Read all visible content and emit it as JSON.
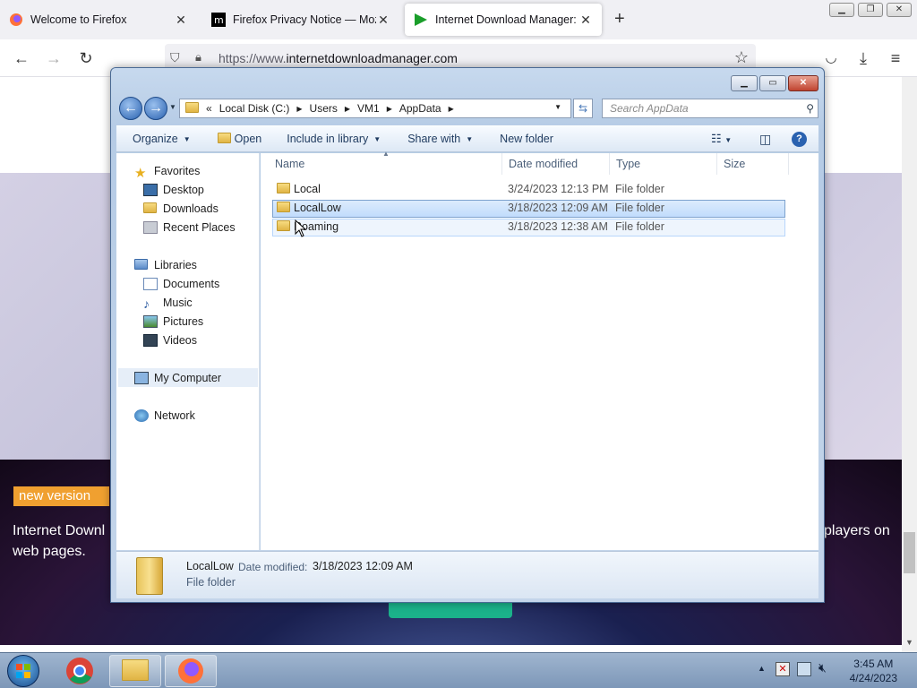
{
  "browser": {
    "tabs": [
      {
        "label": "Welcome to Firefox",
        "icon": "firefox-icon"
      },
      {
        "label": "Firefox Privacy Notice — Mozilla",
        "icon": "mozilla-m-icon"
      },
      {
        "label": "Internet Download Manager: Th",
        "icon": "idm-play-icon",
        "active": true
      }
    ],
    "new_tab": "+",
    "url_prefix": "https://www.",
    "url_domain": "internetdownloadmanager.com"
  },
  "webpage": {
    "badge": "new version",
    "text_left_1": "Internet Downl",
    "text_left_2": "web pages.",
    "text_right": "players on"
  },
  "explorer": {
    "breadcrumb": [
      "«",
      "Local Disk (C:)",
      "Users",
      "VM1",
      "AppData"
    ],
    "search_placeholder": "Search AppData",
    "toolbar": {
      "organize": "Organize",
      "open": "Open",
      "include": "Include in library",
      "share": "Share with",
      "new_folder": "New folder"
    },
    "nav": {
      "favorites": "Favorites",
      "desktop": "Desktop",
      "downloads": "Downloads",
      "recent": "Recent Places",
      "libraries": "Libraries",
      "documents": "Documents",
      "music": "Music",
      "pictures": "Pictures",
      "videos": "Videos",
      "computer": "My Computer",
      "network": "Network"
    },
    "columns": {
      "name": "Name",
      "date": "Date modified",
      "type": "Type",
      "size": "Size"
    },
    "files": [
      {
        "name": "Local",
        "date": "3/24/2023 12:13 PM",
        "type": "File folder"
      },
      {
        "name": "LocalLow",
        "date": "3/18/2023 12:09 AM",
        "type": "File folder",
        "selected": true
      },
      {
        "name": "Roaming",
        "date": "3/18/2023 12:38 AM",
        "type": "File folder",
        "hover": true
      }
    ],
    "details": {
      "name": "LocalLow",
      "date_label": "Date modified:",
      "date_value": "3/18/2023 12:09 AM",
      "type": "File folder"
    }
  },
  "taskbar": {
    "time": "3:45 AM",
    "date": "4/24/2023"
  },
  "colors": {
    "accent": "#3399ff",
    "idm_green": "#1bb28a",
    "badge": "#f0a030"
  }
}
